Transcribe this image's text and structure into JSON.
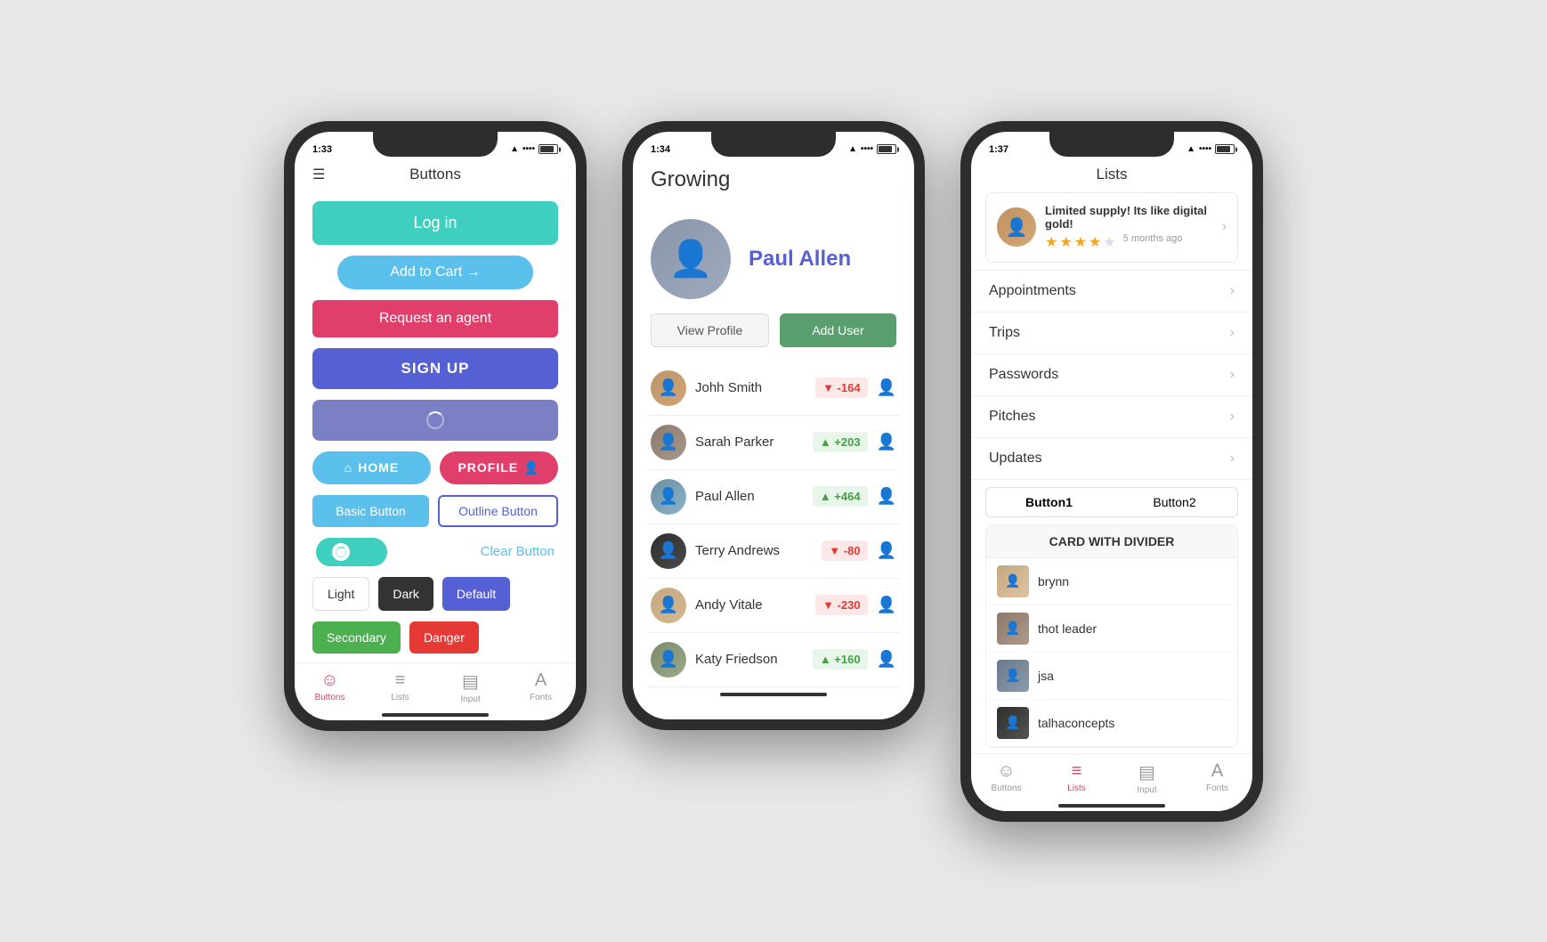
{
  "phone1": {
    "time": "1:33",
    "title": "Buttons",
    "buttons": {
      "login": "Log in",
      "add_cart": "Add to Cart →",
      "request_agent": "Request an agent",
      "signup": "SIGN UP",
      "home": "HOME",
      "profile": "PROFILE",
      "basic": "Basic Button",
      "outline": "Outline Button",
      "clear": "Clear Button",
      "light": "Light",
      "dark": "Dark",
      "default": "Default",
      "secondary": "Secondary",
      "danger": "Danger"
    },
    "tabs": [
      {
        "label": "Buttons",
        "active": true
      },
      {
        "label": "Lists",
        "active": false
      },
      {
        "label": "Input",
        "active": false
      },
      {
        "label": "Fonts",
        "active": false
      }
    ]
  },
  "phone2": {
    "time": "1:34",
    "app_title": "Growing",
    "profile_name": "Paul Allen",
    "btn_view_profile": "View Profile",
    "btn_add_user": "Add User",
    "users": [
      {
        "name": "Johh Smith",
        "score": "-164",
        "positive": false
      },
      {
        "name": "Sarah Parker",
        "score": "+203",
        "positive": true
      },
      {
        "name": "Paul Allen",
        "score": "+464",
        "positive": true
      },
      {
        "name": "Terry Andrews",
        "score": "-80",
        "positive": false
      },
      {
        "name": "Andy Vitale",
        "score": "-230",
        "positive": false
      },
      {
        "name": "Katy Friedson",
        "score": "+160",
        "positive": true
      }
    ]
  },
  "phone3": {
    "time": "1:37",
    "title": "Lists",
    "promo": {
      "text": "Limited supply! Its like digital gold!",
      "time": "5 months ago",
      "stars": [
        true,
        true,
        true,
        true,
        false
      ]
    },
    "menu_items": [
      "Appointments",
      "Trips",
      "Passwords",
      "Pitches",
      "Updates"
    ],
    "segment_buttons": [
      "Button1",
      "Button2"
    ],
    "card_title": "CARD WITH DIVIDER",
    "card_items": [
      "brynn",
      "thot leader",
      "jsa",
      "talhaconcepts"
    ],
    "tabs": [
      {
        "label": "Buttons",
        "active": false
      },
      {
        "label": "Lists",
        "active": true
      },
      {
        "label": "Input",
        "active": false
      },
      {
        "label": "Fonts",
        "active": false
      }
    ]
  }
}
